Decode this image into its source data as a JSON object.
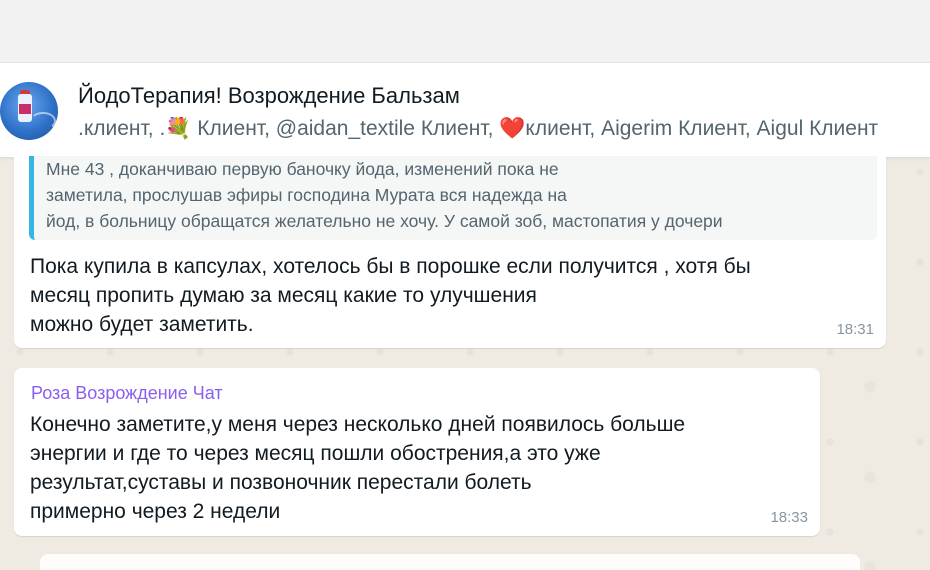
{
  "header": {
    "title": "ЙодоТерапия! Возрождение Бальзам",
    "subtitle": ".клиент, .💐 Клиент, @aidan_textile Клиент, ❤️клиент, Aigerim Клиент, Aigul Клиент"
  },
  "messages": [
    {
      "quote_lines": [
        "Мне 43 , доканчиваю первую баночку йода, изменений пока не",
        "заметила, прослушав эфиры господина Мурата вся надежда на",
        "йод, в больницу обращатся желательно не хочу. У самой зоб, мастопатия у дочери"
      ],
      "text_lines": [
        "Пока купила в капсулах, хотелось бы в порошке если получится , хотя бы",
        "месяц пропить думаю за месяц какие то улучшения",
        "можно будет заметить."
      ],
      "time": "18:31"
    },
    {
      "sender": "Роза Возрождение Чат",
      "text_lines": [
        "Конечно заметите,у меня через несколько дней появилось больше",
        "энергии и где то через месяц пошли обострения,а это уже",
        "результат,суставы и позвоночник перестали болеть",
        "примерно через 2 недели"
      ],
      "time": "18:33"
    }
  ],
  "colors": {
    "quote_accent": "#35b6e9",
    "sender_name": "#8a5ff0",
    "chat_background": "#efeae2"
  },
  "icons": {
    "avatar": "group-avatar-icon"
  }
}
